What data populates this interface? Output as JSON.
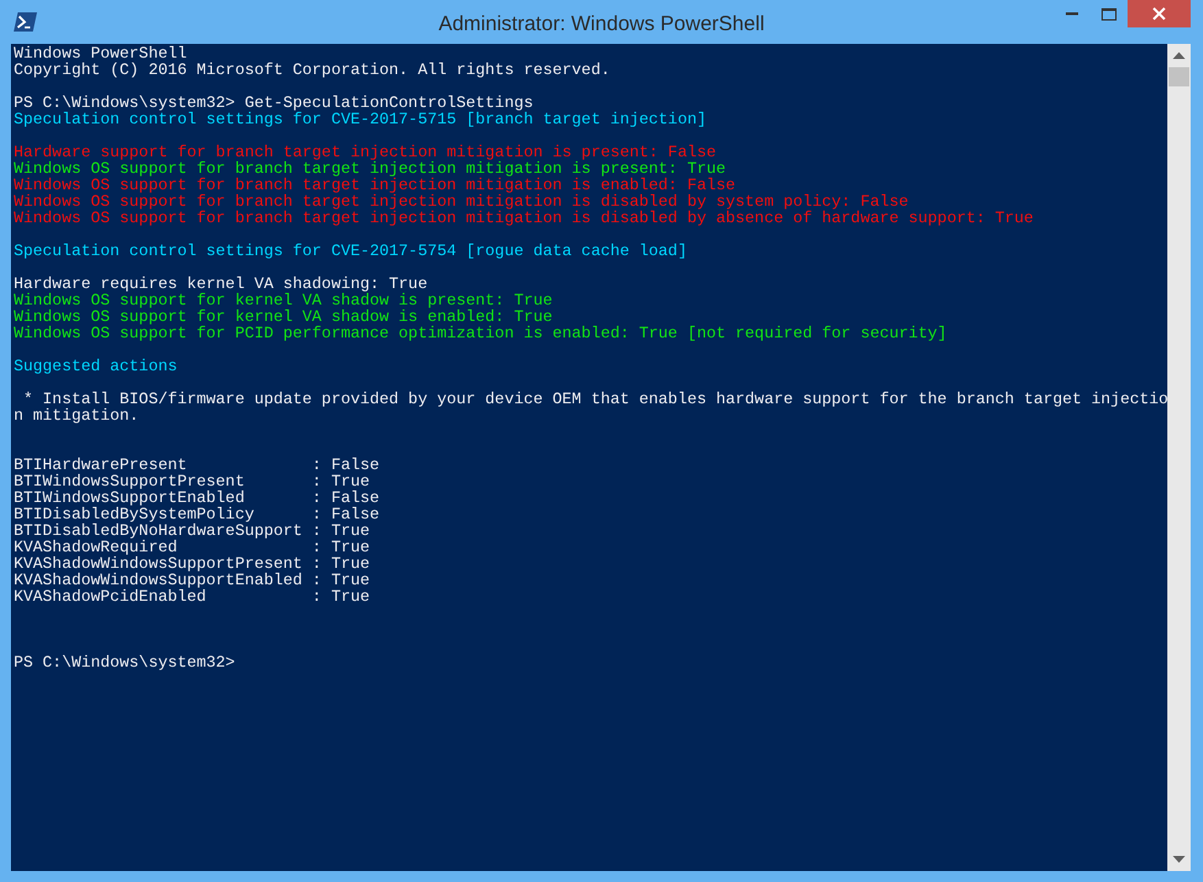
{
  "window": {
    "title": "Administrator: Windows PowerShell",
    "controls": [
      {
        "kind": "minimize"
      },
      {
        "kind": "maximize"
      },
      {
        "kind": "close"
      }
    ]
  },
  "console": {
    "lines": [
      {
        "kind": "plain",
        "text": "Windows PowerShell"
      },
      {
        "kind": "plain",
        "text": "Copyright (C) 2016 Microsoft Corporation. All rights reserved."
      },
      {
        "kind": "blank"
      },
      {
        "kind": "plain",
        "text": "PS C:\\Windows\\system32> Get-SpeculationControlSettings"
      },
      {
        "kind": "heading",
        "text": "Speculation control settings for CVE-2017-5715 [branch target injection]"
      },
      {
        "kind": "blank"
      },
      {
        "kind": "fail",
        "text": "Hardware support for branch target injection mitigation is present: False"
      },
      {
        "kind": "pass",
        "text": "Windows OS support for branch target injection mitigation is present: True"
      },
      {
        "kind": "fail",
        "text": "Windows OS support for branch target injection mitigation is enabled: False"
      },
      {
        "kind": "fail",
        "text": "Windows OS support for branch target injection mitigation is disabled by system policy: False"
      },
      {
        "kind": "fail",
        "text": "Windows OS support for branch target injection mitigation is disabled by absence of hardware support: True"
      },
      {
        "kind": "blank"
      },
      {
        "kind": "heading",
        "text": "Speculation control settings for CVE-2017-5754 [rogue data cache load]"
      },
      {
        "kind": "blank"
      },
      {
        "kind": "plain",
        "text": "Hardware requires kernel VA shadowing: True"
      },
      {
        "kind": "pass",
        "text": "Windows OS support for kernel VA shadow is present: True"
      },
      {
        "kind": "pass",
        "text": "Windows OS support for kernel VA shadow is enabled: True"
      },
      {
        "kind": "pass",
        "text": "Windows OS support for PCID performance optimization is enabled: True [not required for security]"
      },
      {
        "kind": "blank"
      },
      {
        "kind": "heading",
        "text": "Suggested actions"
      },
      {
        "kind": "blank"
      },
      {
        "kind": "plain",
        "text": " * Install BIOS/firmware update provided by your device OEM that enables hardware support for the branch target injectio"
      },
      {
        "kind": "plain",
        "text": "n mitigation."
      },
      {
        "kind": "blank"
      },
      {
        "kind": "blank"
      },
      {
        "kind": "plain",
        "text": "BTIHardwarePresent             : False"
      },
      {
        "kind": "plain",
        "text": "BTIWindowsSupportPresent       : True"
      },
      {
        "kind": "plain",
        "text": "BTIWindowsSupportEnabled       : False"
      },
      {
        "kind": "plain",
        "text": "BTIDisabledBySystemPolicy      : False"
      },
      {
        "kind": "plain",
        "text": "BTIDisabledByNoHardwareSupport : True"
      },
      {
        "kind": "plain",
        "text": "KVAShadowRequired              : True"
      },
      {
        "kind": "plain",
        "text": "KVAShadowWindowsSupportPresent : True"
      },
      {
        "kind": "plain",
        "text": "KVAShadowWindowsSupportEnabled : True"
      },
      {
        "kind": "plain",
        "text": "KVAShadowPcidEnabled           : True"
      },
      {
        "kind": "blank"
      },
      {
        "kind": "blank"
      },
      {
        "kind": "blank"
      },
      {
        "kind": "plain",
        "text": "PS C:\\Windows\\system32>"
      }
    ]
  }
}
